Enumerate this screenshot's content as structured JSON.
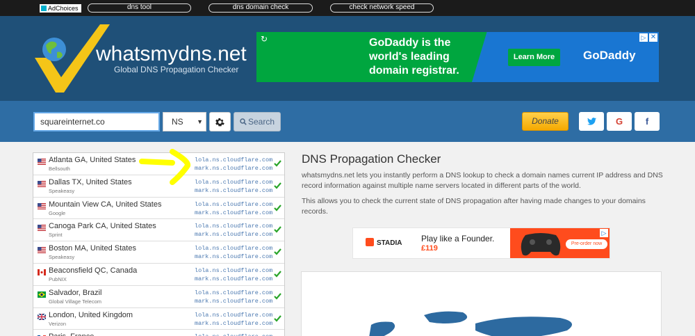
{
  "topbar": {
    "adchoices": "AdChoices",
    "links": [
      "dns tool",
      "dns domain check",
      "check network speed"
    ]
  },
  "header": {
    "title": "whatsmydns.net",
    "subtitle": "Global DNS Propagation Checker"
  },
  "ad_godaddy": {
    "headline": "GoDaddy is the world's leading domain registrar.",
    "cta": "Learn More",
    "brand": "GoDaddy"
  },
  "search": {
    "query": "squareinternet.co",
    "record_type": "NS",
    "search_label": "Search",
    "donate_label": "Donate"
  },
  "social": {
    "twitter": "t",
    "google": "G",
    "facebook": "f"
  },
  "results": [
    {
      "location": "Atlanta GA, United States",
      "isp": "Bellsouth",
      "flag": "us",
      "ns1": "lola.ns.cloudflare.com",
      "ns2": "mark.ns.cloudflare.com"
    },
    {
      "location": "Dallas TX, United States",
      "isp": "Speakeasy",
      "flag": "us",
      "ns1": "lola.ns.cloudflare.com",
      "ns2": "mark.ns.cloudflare.com"
    },
    {
      "location": "Mountain View CA, United States",
      "isp": "Google",
      "flag": "us",
      "ns1": "lola.ns.cloudflare.com",
      "ns2": "mark.ns.cloudflare.com"
    },
    {
      "location": "Canoga Park CA, United States",
      "isp": "Sprint",
      "flag": "us",
      "ns1": "lola.ns.cloudflare.com",
      "ns2": "mark.ns.cloudflare.com"
    },
    {
      "location": "Boston MA, United States",
      "isp": "Speakeasy",
      "flag": "us",
      "ns1": "lola.ns.cloudflare.com",
      "ns2": "mark.ns.cloudflare.com"
    },
    {
      "location": "Beaconsfield QC, Canada",
      "isp": "PubNIX",
      "flag": "ca",
      "ns1": "lola.ns.cloudflare.com",
      "ns2": "mark.ns.cloudflare.com"
    },
    {
      "location": "Salvador, Brazil",
      "isp": "Global Village Telecom",
      "flag": "br",
      "ns1": "lola.ns.cloudflare.com",
      "ns2": "mark.ns.cloudflare.com"
    },
    {
      "location": "London, United Kingdom",
      "isp": "Verizon",
      "flag": "gb",
      "ns1": "lola.ns.cloudflare.com",
      "ns2": "mark.ns.cloudflare.com"
    },
    {
      "location": "Paris, France",
      "isp": "",
      "flag": "fr",
      "ns1": "lola.ns.cloudflare.com",
      "ns2": ""
    }
  ],
  "main": {
    "title": "DNS Propagation Checker",
    "p1": "whatsmydns.net lets you instantly perform a DNS lookup to check a domain names current IP address and DNS record information against multiple name servers located in different parts of the world.",
    "p2": "This allows you to check the current state of DNS propagation after having made changes to your domains records."
  },
  "ad_stadia": {
    "brand": "STADIA",
    "headline": "Play like a Founder.",
    "price": "£119",
    "cta": "Pre-order now"
  },
  "colors": {
    "header": "#1f5078",
    "searchbar": "#2e6da4",
    "godaddy_green": "#00a63f",
    "godaddy_blue": "#1976d2",
    "stadia_orange": "#ff4c1d",
    "success_green": "#2aa52a",
    "annotation_yellow": "#ffff00"
  }
}
